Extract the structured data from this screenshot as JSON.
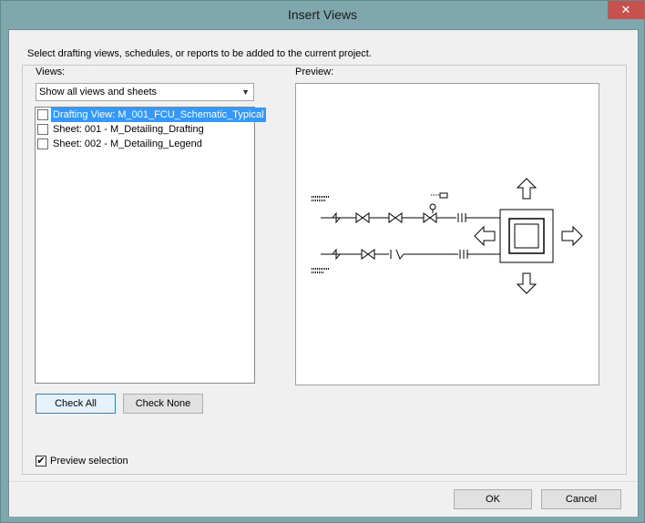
{
  "window": {
    "title": "Insert Views",
    "close_glyph": "✕"
  },
  "instructions": "Select drafting views, schedules, or reports to be added to the current project.",
  "views": {
    "label": "Views:",
    "filter_selected": "Show all views and sheets",
    "items": [
      {
        "label": "Drafting View: M_001_FCU_Schematic_Typical",
        "checked": false,
        "selected": true
      },
      {
        "label": "Sheet: 001 - M_Detailing_Drafting",
        "checked": false,
        "selected": false
      },
      {
        "label": "Sheet: 002 - M_Detailing_Legend",
        "checked": false,
        "selected": false
      }
    ]
  },
  "buttons": {
    "check_all": "Check All",
    "check_none": "Check None",
    "ok": "OK",
    "cancel": "Cancel"
  },
  "preview": {
    "label": "Preview:"
  },
  "preview_selection": {
    "label": "Preview selection",
    "checked": true,
    "check_glyph": "✔"
  }
}
